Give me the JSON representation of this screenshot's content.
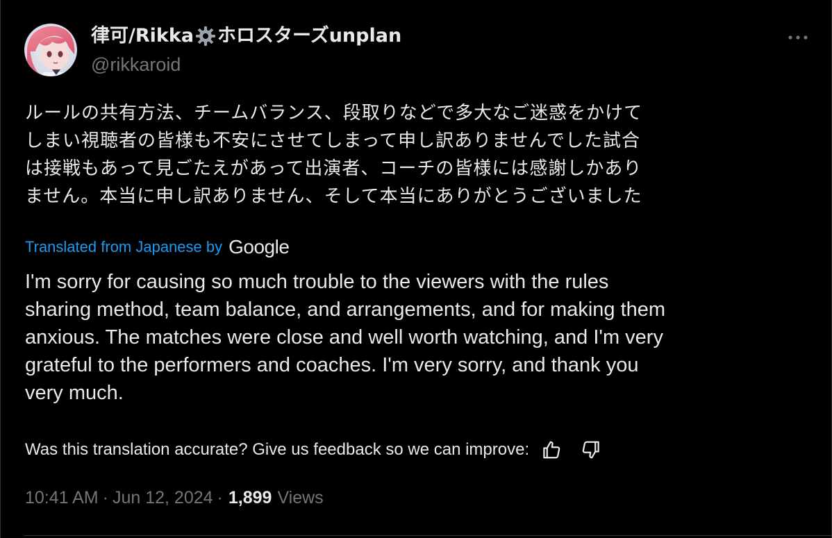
{
  "author": {
    "name_part1": "律可/Rikka",
    "name_part2": "ホロスターズunplan",
    "handle": "@rikkaroid"
  },
  "tweet": {
    "jp_lines": [
      "ルールの共有方法、チームバランス、段取りなどで多大なご迷惑をかけて",
      "しまい視聴者の皆様も不安にさせてしまって申し訳ありませんでした試合",
      "は接戦もあって見ごたえがあって出演者、コーチの皆様には感謝しかあり",
      "ません。本当に申し訳ありません、そして本当にありがとうございました"
    ],
    "translated_label": "Translated from Japanese by",
    "translator": "Google",
    "en_lines": [
      "I'm sorry for causing so much trouble to the viewers with the rules",
      "sharing method, team balance, and arrangements, and for making them",
      "anxious. The matches were close and well worth watching, and I'm very",
      "grateful to the performers and coaches. I'm very sorry, and thank you",
      "very much."
    ]
  },
  "feedback": {
    "question": "Was this translation accurate? Give us feedback so we can improve:"
  },
  "meta": {
    "time": "10:41 AM",
    "date": "Jun 12, 2024",
    "separator": "·",
    "views_count": "1,899",
    "views_label": "Views"
  },
  "colors": {
    "background": "#000000",
    "text": "#e7e9ea",
    "muted": "#71767b",
    "link": "#1d9bf0"
  },
  "icons": [
    "more-icon",
    "gear-icon",
    "thumbs-up-icon",
    "thumbs-down-icon"
  ]
}
